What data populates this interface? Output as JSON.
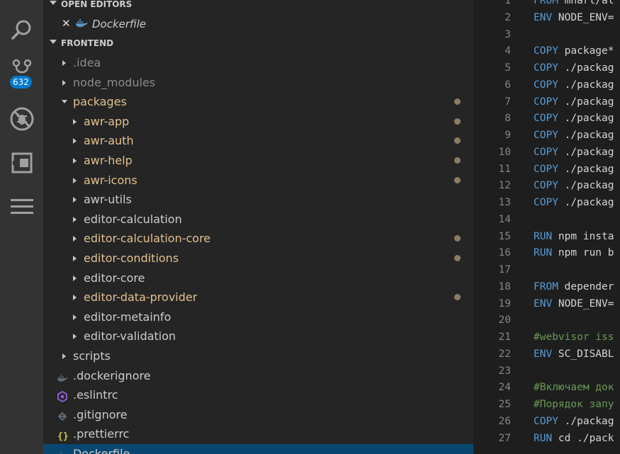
{
  "activity_bar": {
    "badge": "632"
  },
  "sidebar": {
    "open_editors_header": "OPEN EDITORS",
    "open_editor_file": "Dockerfile",
    "folder_header": "FRONTEND",
    "tree": [
      {
        "name": ".idea",
        "depth": 1,
        "kind": "folder",
        "state": "collapsed",
        "style": "dim",
        "modified": false
      },
      {
        "name": "node_modules",
        "depth": 1,
        "kind": "folder",
        "state": "collapsed",
        "style": "dim",
        "modified": false
      },
      {
        "name": "packages",
        "depth": 1,
        "kind": "folder",
        "state": "expanded",
        "style": "mod",
        "modified": true
      },
      {
        "name": "awr-app",
        "depth": 2,
        "kind": "folder",
        "state": "collapsed",
        "style": "mod",
        "modified": true
      },
      {
        "name": "awr-auth",
        "depth": 2,
        "kind": "folder",
        "state": "collapsed",
        "style": "mod",
        "modified": true
      },
      {
        "name": "awr-help",
        "depth": 2,
        "kind": "folder",
        "state": "collapsed",
        "style": "mod",
        "modified": true
      },
      {
        "name": "awr-icons",
        "depth": 2,
        "kind": "folder",
        "state": "collapsed",
        "style": "mod",
        "modified": true
      },
      {
        "name": "awr-utils",
        "depth": 2,
        "kind": "folder",
        "state": "collapsed",
        "style": "normal",
        "modified": false
      },
      {
        "name": "editor-calculation",
        "depth": 2,
        "kind": "folder",
        "state": "collapsed",
        "style": "normal",
        "modified": false
      },
      {
        "name": "editor-calculation-core",
        "depth": 2,
        "kind": "folder",
        "state": "collapsed",
        "style": "mod",
        "modified": true
      },
      {
        "name": "editor-conditions",
        "depth": 2,
        "kind": "folder",
        "state": "collapsed",
        "style": "mod",
        "modified": true
      },
      {
        "name": "editor-core",
        "depth": 2,
        "kind": "folder",
        "state": "collapsed",
        "style": "normal",
        "modified": false
      },
      {
        "name": "editor-data-provider",
        "depth": 2,
        "kind": "folder",
        "state": "collapsed",
        "style": "mod",
        "modified": true
      },
      {
        "name": "editor-metainfo",
        "depth": 2,
        "kind": "folder",
        "state": "collapsed",
        "style": "normal",
        "modified": false
      },
      {
        "name": "editor-validation",
        "depth": 2,
        "kind": "folder",
        "state": "collapsed",
        "style": "normal",
        "modified": false
      },
      {
        "name": "scripts",
        "depth": 1,
        "kind": "folder",
        "state": "collapsed",
        "style": "normal",
        "modified": false
      },
      {
        "name": ".dockerignore",
        "depth": 1,
        "kind": "file",
        "icon": "docker-icon",
        "style": "normal",
        "modified": false
      },
      {
        "name": ".eslintrc",
        "depth": 1,
        "kind": "file",
        "icon": "eslint-icon",
        "style": "normal",
        "modified": false
      },
      {
        "name": ".gitignore",
        "depth": 1,
        "kind": "file",
        "icon": "git-icon",
        "style": "normal",
        "modified": false
      },
      {
        "name": ".prettierrc",
        "depth": 1,
        "kind": "file",
        "icon": "json-braces-icon",
        "style": "normal",
        "modified": false
      },
      {
        "name": "Dockerfile",
        "depth": 1,
        "kind": "file",
        "icon": "docker-icon",
        "style": "normal",
        "modified": false,
        "selected": true
      }
    ]
  },
  "editor": {
    "lines": [
      {
        "n": "1",
        "parts": [
          {
            "t": "FROM",
            "c": "kw"
          },
          {
            "t": " mhart/al",
            "c": ""
          }
        ]
      },
      {
        "n": "2",
        "parts": [
          {
            "t": "ENV",
            "c": "kw"
          },
          {
            "t": " NODE_ENV=",
            "c": ""
          }
        ]
      },
      {
        "n": "3",
        "parts": []
      },
      {
        "n": "4",
        "parts": [
          {
            "t": "COPY",
            "c": "kw"
          },
          {
            "t": " package*",
            "c": ""
          }
        ]
      },
      {
        "n": "5",
        "parts": [
          {
            "t": "COPY",
            "c": "kw"
          },
          {
            "t": " ./packag",
            "c": ""
          }
        ]
      },
      {
        "n": "6",
        "parts": [
          {
            "t": "COPY",
            "c": "kw"
          },
          {
            "t": " ./packag",
            "c": ""
          }
        ]
      },
      {
        "n": "7",
        "parts": [
          {
            "t": "COPY",
            "c": "kw"
          },
          {
            "t": " ./packag",
            "c": ""
          }
        ]
      },
      {
        "n": "8",
        "parts": [
          {
            "t": "COPY",
            "c": "kw"
          },
          {
            "t": " ./packag",
            "c": ""
          }
        ]
      },
      {
        "n": "9",
        "parts": [
          {
            "t": "COPY",
            "c": "kw"
          },
          {
            "t": " ./packag",
            "c": ""
          }
        ]
      },
      {
        "n": "10",
        "parts": [
          {
            "t": "COPY",
            "c": "kw"
          },
          {
            "t": " ./packag",
            "c": ""
          }
        ]
      },
      {
        "n": "11",
        "parts": [
          {
            "t": "COPY",
            "c": "kw"
          },
          {
            "t": " ./packag",
            "c": ""
          }
        ]
      },
      {
        "n": "12",
        "parts": [
          {
            "t": "COPY",
            "c": "kw"
          },
          {
            "t": " ./packag",
            "c": ""
          }
        ]
      },
      {
        "n": "13",
        "parts": [
          {
            "t": "COPY",
            "c": "kw"
          },
          {
            "t": " ./packag",
            "c": ""
          }
        ]
      },
      {
        "n": "14",
        "parts": []
      },
      {
        "n": "15",
        "parts": [
          {
            "t": "RUN",
            "c": "kw"
          },
          {
            "t": " npm insta",
            "c": ""
          }
        ]
      },
      {
        "n": "16",
        "parts": [
          {
            "t": "RUN",
            "c": "kw"
          },
          {
            "t": " npm run b",
            "c": ""
          }
        ]
      },
      {
        "n": "17",
        "parts": []
      },
      {
        "n": "18",
        "parts": [
          {
            "t": "FROM",
            "c": "kw"
          },
          {
            "t": " depender",
            "c": ""
          }
        ]
      },
      {
        "n": "19",
        "parts": [
          {
            "t": "ENV",
            "c": "kw"
          },
          {
            "t": " NODE_ENV=",
            "c": ""
          }
        ]
      },
      {
        "n": "20",
        "parts": []
      },
      {
        "n": "21",
        "parts": [
          {
            "t": "#webvisor iss",
            "c": "cm"
          }
        ]
      },
      {
        "n": "22",
        "parts": [
          {
            "t": "ENV",
            "c": "kw"
          },
          {
            "t": " SC_DISABL",
            "c": ""
          }
        ]
      },
      {
        "n": "23",
        "parts": []
      },
      {
        "n": "24",
        "parts": [
          {
            "t": "#Включаем док",
            "c": "cm"
          }
        ]
      },
      {
        "n": "25",
        "parts": [
          {
            "t": "#Порядок запу",
            "c": "cm"
          }
        ]
      },
      {
        "n": "26",
        "parts": [
          {
            "t": "COPY",
            "c": "kw"
          },
          {
            "t": " ./packag",
            "c": ""
          }
        ]
      },
      {
        "n": "27",
        "parts": [
          {
            "t": "RUN",
            "c": "kw"
          },
          {
            "t": " cd ./pack",
            "c": ""
          }
        ]
      }
    ]
  }
}
